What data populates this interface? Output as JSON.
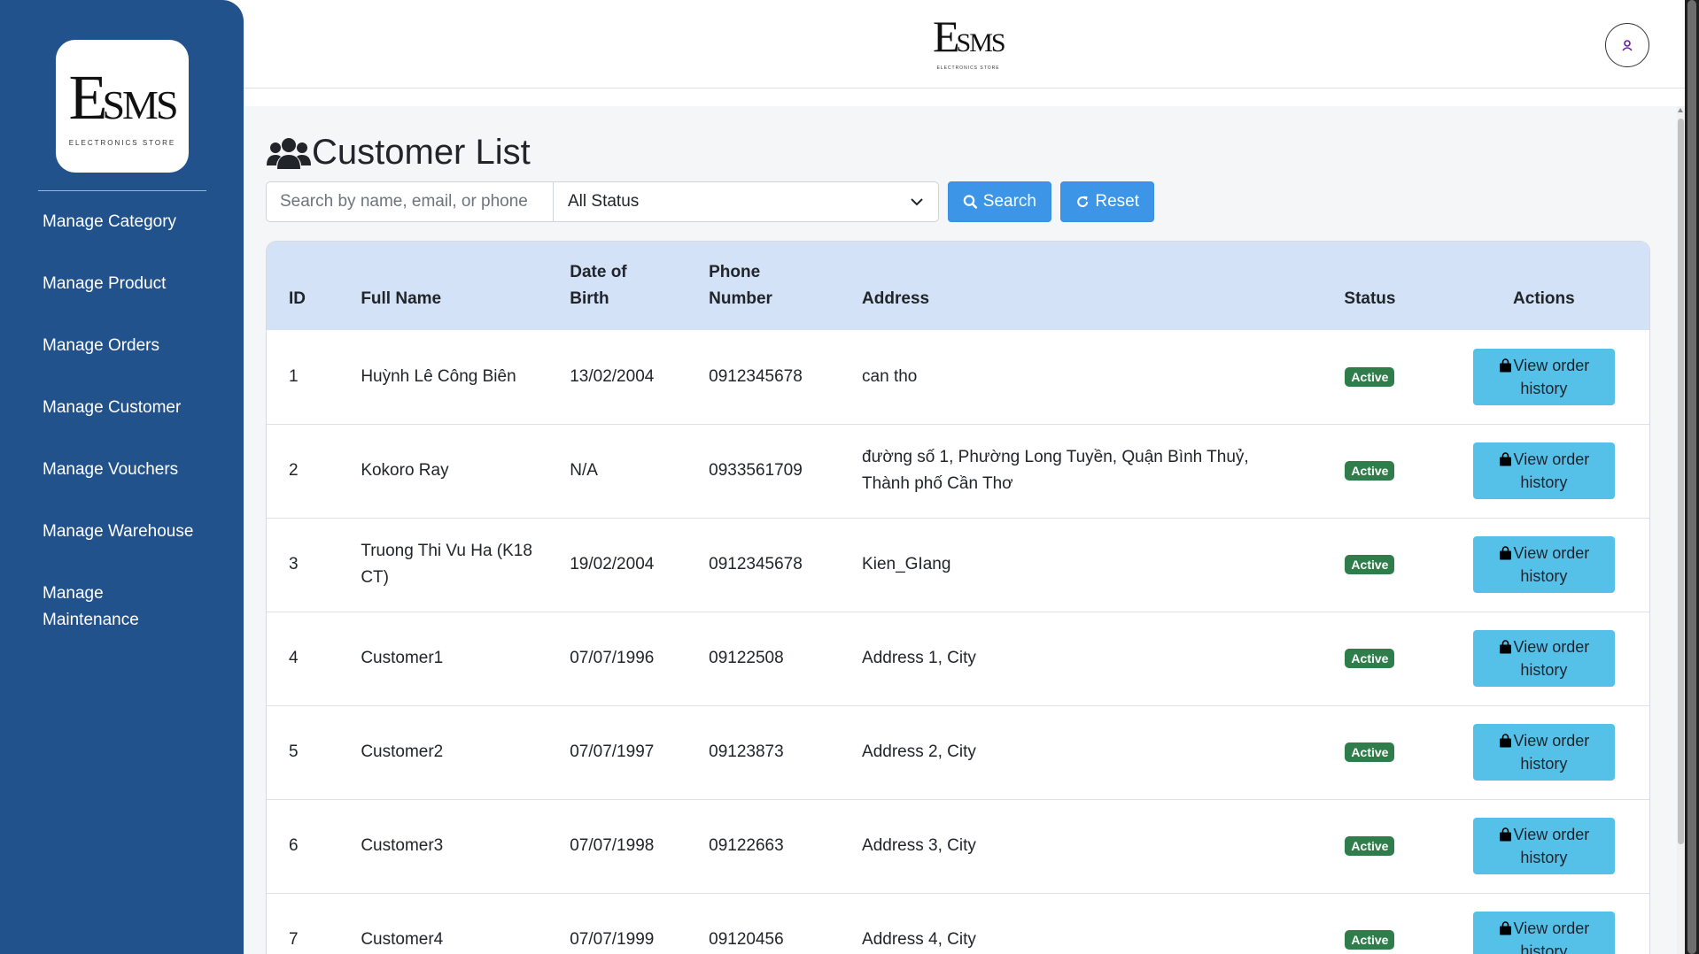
{
  "brand": {
    "logo_mark": "ESMS",
    "logo_sub": "ELECTRONICS STORE"
  },
  "sidebar": {
    "items": [
      {
        "label": "Manage Category"
      },
      {
        "label": "Manage Product"
      },
      {
        "label": "Manage Orders"
      },
      {
        "label": "Manage Customer"
      },
      {
        "label": "Manage Vouchers"
      },
      {
        "label": "Manage Warehouse"
      },
      {
        "label": "Manage Maintenance"
      }
    ]
  },
  "header": {
    "avatar_icon": "user-icon"
  },
  "page": {
    "title": "Customer List",
    "title_icon": "users-icon"
  },
  "filters": {
    "search_placeholder": "Search by name, email, or phone",
    "search_value": "",
    "status_selected": "All Status",
    "search_button": "Search",
    "reset_button": "Reset"
  },
  "table": {
    "headers": {
      "id": "ID",
      "full_name": "Full Name",
      "dob": "Date of Birth",
      "phone": "Phone Number",
      "address": "Address",
      "status": "Status",
      "actions": "Actions"
    },
    "action_label": "View order history",
    "rows": [
      {
        "id": "1",
        "name": "Huỳnh Lê Công Biên",
        "dob": "13/02/2004",
        "phone": "0912345678",
        "address": "can tho",
        "status": "Active"
      },
      {
        "id": "2",
        "name": "Kokoro Ray",
        "dob": "N/A",
        "phone": "0933561709",
        "address": "đường số 1, Phường Long Tuyền, Quận Bình Thuỷ, Thành phố Cần Thơ",
        "status": "Active"
      },
      {
        "id": "3",
        "name": "Truong Thi Vu Ha (K18 CT)",
        "dob": "19/02/2004",
        "phone": "0912345678",
        "address": "Kien_GIang",
        "status": "Active"
      },
      {
        "id": "4",
        "name": "Customer1",
        "dob": "07/07/1996",
        "phone": "09122508",
        "address": "Address 1, City",
        "status": "Active"
      },
      {
        "id": "5",
        "name": "Customer2",
        "dob": "07/07/1997",
        "phone": "09123873",
        "address": "Address 2, City",
        "status": "Active"
      },
      {
        "id": "6",
        "name": "Customer3",
        "dob": "07/07/1998",
        "phone": "09122663",
        "address": "Address 3, City",
        "status": "Active"
      },
      {
        "id": "7",
        "name": "Customer4",
        "dob": "07/07/1999",
        "phone": "09120456",
        "address": "Address 4, City",
        "status": "Active"
      }
    ]
  },
  "colors": {
    "sidebar_bg": "#22528c",
    "primary_button": "#3c95e6",
    "info_button": "#56c1e8",
    "badge_success": "#2f7d4a",
    "table_header": "#d3e2f6"
  }
}
